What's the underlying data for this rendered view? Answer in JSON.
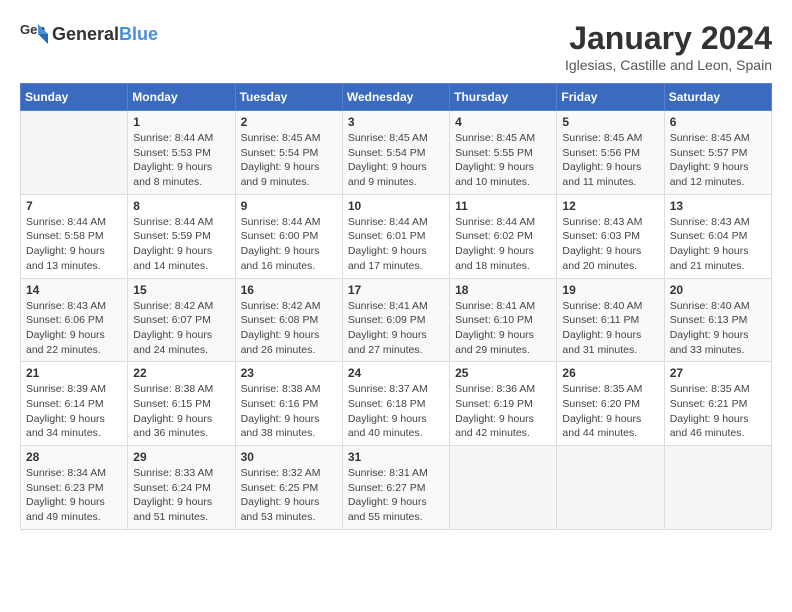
{
  "header": {
    "logo_general": "General",
    "logo_blue": "Blue",
    "title": "January 2024",
    "subtitle": "Iglesias, Castille and Leon, Spain"
  },
  "calendar": {
    "days_of_week": [
      "Sunday",
      "Monday",
      "Tuesday",
      "Wednesday",
      "Thursday",
      "Friday",
      "Saturday"
    ],
    "weeks": [
      [
        {
          "day": "",
          "info": ""
        },
        {
          "day": "1",
          "info": "Sunrise: 8:44 AM\nSunset: 5:53 PM\nDaylight: 9 hours\nand 8 minutes."
        },
        {
          "day": "2",
          "info": "Sunrise: 8:45 AM\nSunset: 5:54 PM\nDaylight: 9 hours\nand 9 minutes."
        },
        {
          "day": "3",
          "info": "Sunrise: 8:45 AM\nSunset: 5:54 PM\nDaylight: 9 hours\nand 9 minutes."
        },
        {
          "day": "4",
          "info": "Sunrise: 8:45 AM\nSunset: 5:55 PM\nDaylight: 9 hours\nand 10 minutes."
        },
        {
          "day": "5",
          "info": "Sunrise: 8:45 AM\nSunset: 5:56 PM\nDaylight: 9 hours\nand 11 minutes."
        },
        {
          "day": "6",
          "info": "Sunrise: 8:45 AM\nSunset: 5:57 PM\nDaylight: 9 hours\nand 12 minutes."
        }
      ],
      [
        {
          "day": "7",
          "info": "Sunrise: 8:44 AM\nSunset: 5:58 PM\nDaylight: 9 hours\nand 13 minutes."
        },
        {
          "day": "8",
          "info": "Sunrise: 8:44 AM\nSunset: 5:59 PM\nDaylight: 9 hours\nand 14 minutes."
        },
        {
          "day": "9",
          "info": "Sunrise: 8:44 AM\nSunset: 6:00 PM\nDaylight: 9 hours\nand 16 minutes."
        },
        {
          "day": "10",
          "info": "Sunrise: 8:44 AM\nSunset: 6:01 PM\nDaylight: 9 hours\nand 17 minutes."
        },
        {
          "day": "11",
          "info": "Sunrise: 8:44 AM\nSunset: 6:02 PM\nDaylight: 9 hours\nand 18 minutes."
        },
        {
          "day": "12",
          "info": "Sunrise: 8:43 AM\nSunset: 6:03 PM\nDaylight: 9 hours\nand 20 minutes."
        },
        {
          "day": "13",
          "info": "Sunrise: 8:43 AM\nSunset: 6:04 PM\nDaylight: 9 hours\nand 21 minutes."
        }
      ],
      [
        {
          "day": "14",
          "info": "Sunrise: 8:43 AM\nSunset: 6:06 PM\nDaylight: 9 hours\nand 22 minutes."
        },
        {
          "day": "15",
          "info": "Sunrise: 8:42 AM\nSunset: 6:07 PM\nDaylight: 9 hours\nand 24 minutes."
        },
        {
          "day": "16",
          "info": "Sunrise: 8:42 AM\nSunset: 6:08 PM\nDaylight: 9 hours\nand 26 minutes."
        },
        {
          "day": "17",
          "info": "Sunrise: 8:41 AM\nSunset: 6:09 PM\nDaylight: 9 hours\nand 27 minutes."
        },
        {
          "day": "18",
          "info": "Sunrise: 8:41 AM\nSunset: 6:10 PM\nDaylight: 9 hours\nand 29 minutes."
        },
        {
          "day": "19",
          "info": "Sunrise: 8:40 AM\nSunset: 6:11 PM\nDaylight: 9 hours\nand 31 minutes."
        },
        {
          "day": "20",
          "info": "Sunrise: 8:40 AM\nSunset: 6:13 PM\nDaylight: 9 hours\nand 33 minutes."
        }
      ],
      [
        {
          "day": "21",
          "info": "Sunrise: 8:39 AM\nSunset: 6:14 PM\nDaylight: 9 hours\nand 34 minutes."
        },
        {
          "day": "22",
          "info": "Sunrise: 8:38 AM\nSunset: 6:15 PM\nDaylight: 9 hours\nand 36 minutes."
        },
        {
          "day": "23",
          "info": "Sunrise: 8:38 AM\nSunset: 6:16 PM\nDaylight: 9 hours\nand 38 minutes."
        },
        {
          "day": "24",
          "info": "Sunrise: 8:37 AM\nSunset: 6:18 PM\nDaylight: 9 hours\nand 40 minutes."
        },
        {
          "day": "25",
          "info": "Sunrise: 8:36 AM\nSunset: 6:19 PM\nDaylight: 9 hours\nand 42 minutes."
        },
        {
          "day": "26",
          "info": "Sunrise: 8:35 AM\nSunset: 6:20 PM\nDaylight: 9 hours\nand 44 minutes."
        },
        {
          "day": "27",
          "info": "Sunrise: 8:35 AM\nSunset: 6:21 PM\nDaylight: 9 hours\nand 46 minutes."
        }
      ],
      [
        {
          "day": "28",
          "info": "Sunrise: 8:34 AM\nSunset: 6:23 PM\nDaylight: 9 hours\nand 49 minutes."
        },
        {
          "day": "29",
          "info": "Sunrise: 8:33 AM\nSunset: 6:24 PM\nDaylight: 9 hours\nand 51 minutes."
        },
        {
          "day": "30",
          "info": "Sunrise: 8:32 AM\nSunset: 6:25 PM\nDaylight: 9 hours\nand 53 minutes."
        },
        {
          "day": "31",
          "info": "Sunrise: 8:31 AM\nSunset: 6:27 PM\nDaylight: 9 hours\nand 55 minutes."
        },
        {
          "day": "",
          "info": ""
        },
        {
          "day": "",
          "info": ""
        },
        {
          "day": "",
          "info": ""
        }
      ]
    ]
  }
}
